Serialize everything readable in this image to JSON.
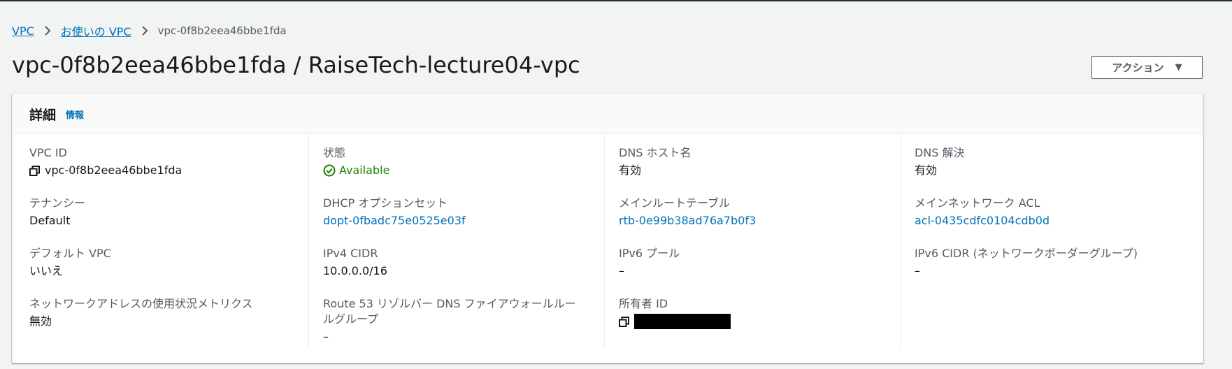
{
  "breadcrumb": {
    "items": [
      "VPC",
      "お使いの VPC"
    ],
    "current": "vpc-0f8b2eea46bbe1fda"
  },
  "page": {
    "title": "vpc-0f8b2eea46bbe1fda / RaiseTech-lecture04-vpc"
  },
  "actions": {
    "label": "アクション",
    "caret": "▼"
  },
  "details": {
    "title": "詳細",
    "info_link": "情報",
    "columns": [
      [
        {
          "label": "VPC ID",
          "value": "vpc-0f8b2eea46bbe1fda",
          "copy": true
        },
        {
          "label": "テナンシー",
          "value": "Default"
        },
        {
          "label": "デフォルト VPC",
          "value": "いいえ"
        },
        {
          "label": "ネットワークアドレスの使用状況メトリクス",
          "value": "無効"
        }
      ],
      [
        {
          "label": "状態",
          "value": "Available",
          "status": "success"
        },
        {
          "label": "DHCP オプションセット",
          "value": "dopt-0fbadc75e0525e03f",
          "link": true
        },
        {
          "label": "IPv4 CIDR",
          "value": "10.0.0.0/16"
        },
        {
          "label": "Route 53 リゾルバー DNS ファイアウォールルールグループ",
          "value": "–"
        }
      ],
      [
        {
          "label": "DNS ホスト名",
          "value": "有効"
        },
        {
          "label": "メインルートテーブル",
          "value": "rtb-0e99b38ad76a7b0f3",
          "link": true
        },
        {
          "label": "IPv6 プール",
          "value": "–"
        },
        {
          "label": "所有者 ID",
          "value": "",
          "copy": true,
          "redacted": true
        }
      ],
      [
        {
          "label": "DNS 解決",
          "value": "有効"
        },
        {
          "label": "メインネットワーク ACL",
          "value": "acl-0435cdfc0104cdb0d",
          "link": true
        },
        {
          "label": "IPv6 CIDR (ネットワークボーダーグループ)",
          "value": "–"
        }
      ]
    ]
  },
  "colors": {
    "link": "#0073bb",
    "success": "#1d8102",
    "text": "#16191f",
    "label": "#545b64"
  }
}
